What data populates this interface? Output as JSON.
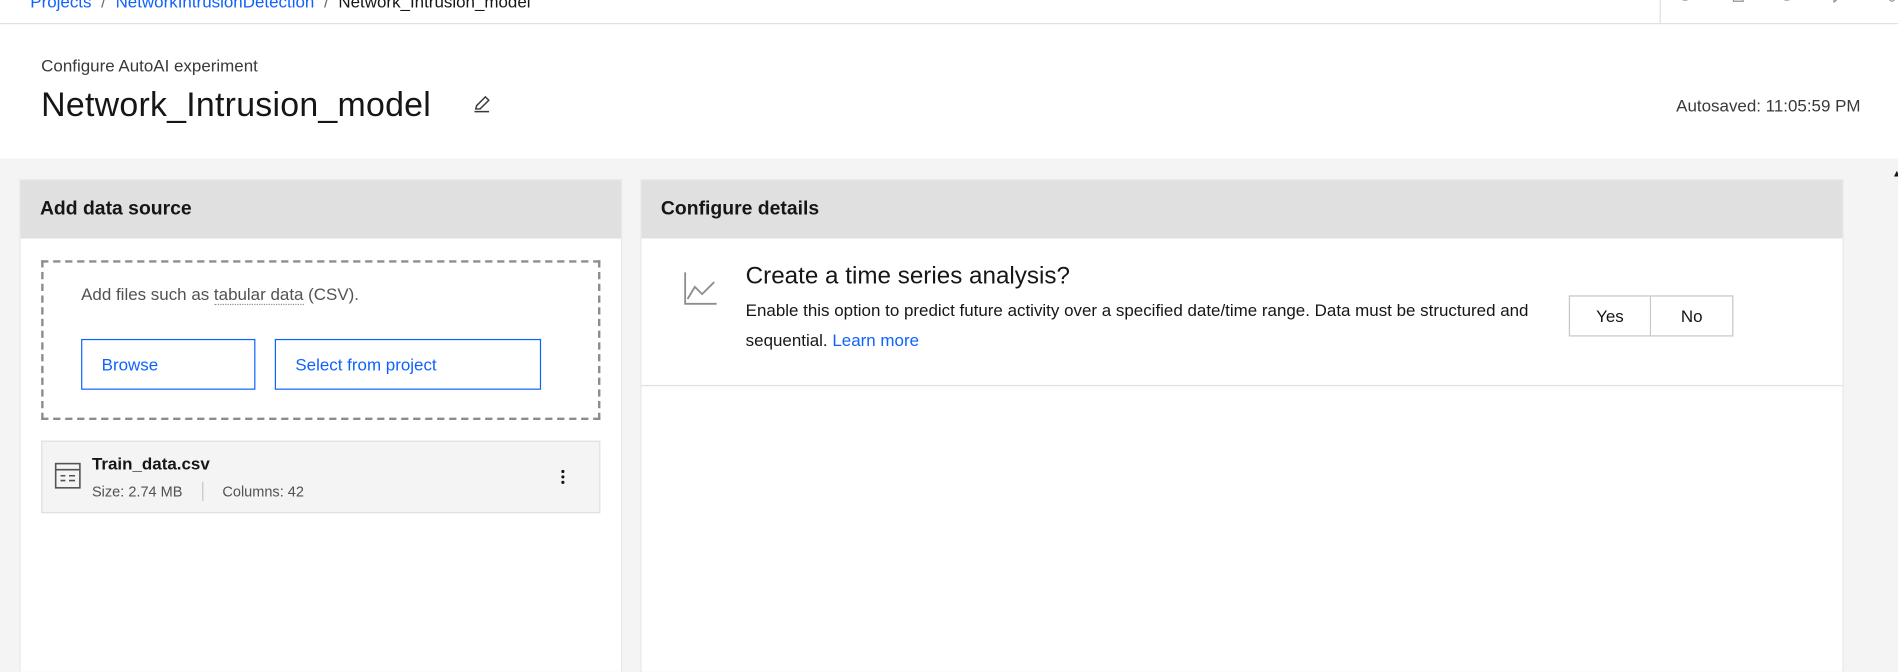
{
  "breadcrumb": {
    "items": [
      "Projects",
      "NetworkIntrusionDetection",
      "Network_Intrusion_model"
    ],
    "separator": "/"
  },
  "topbar": {
    "icons": [
      "info-icon",
      "flow-icon",
      "history-icon",
      "chat-icon",
      "share-icon"
    ]
  },
  "header": {
    "subtitle": "Configure AutoAI experiment",
    "title": "Network_Intrusion_model",
    "autosaved": "Autosaved: 11:05:59 PM"
  },
  "data_source": {
    "heading": "Add data source",
    "hint_prefix": "Add files such as ",
    "hint_term": "tabular data",
    "hint_suffix": " (CSV).",
    "browse_label": "Browse",
    "select_label": "Select from project",
    "file": {
      "name": "Train_data.csv",
      "size": "Size: 2.74 MB",
      "columns": "Columns: 42"
    }
  },
  "configure": {
    "heading": "Configure details",
    "ts_title": "Create a time series analysis?",
    "ts_desc": "Enable this option to predict future activity over a specified date/time range. Data must be structured and sequential. ",
    "learn_more": "Learn more",
    "yes_label": "Yes",
    "no_label": "No"
  },
  "colors": {
    "link": "#0f62fe",
    "panel_header": "#e0e0e0",
    "background": "#f4f4f4"
  }
}
